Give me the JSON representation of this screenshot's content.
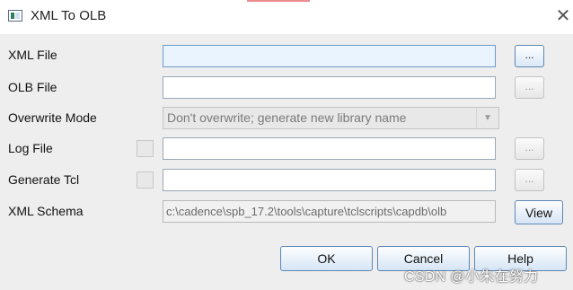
{
  "window": {
    "title": "XML To OLB"
  },
  "rows": {
    "xml_file": {
      "label": "XML File",
      "value": "",
      "browse_label": "..."
    },
    "olb_file": {
      "label": "OLB File",
      "value": "",
      "browse_label": "..."
    },
    "overwrite_mode": {
      "label": "Overwrite Mode",
      "selected": "Don't overwrite; generate new library name"
    },
    "log_file": {
      "label": "Log File",
      "value": "",
      "browse_label": "..."
    },
    "generate_tcl": {
      "label": "Generate Tcl",
      "value": "",
      "browse_label": "..."
    },
    "xml_schema": {
      "label": "XML Schema",
      "value": "c:\\cadence\\spb_17.2\\tools\\capture\\tclscripts\\capdb\\olb",
      "view_label": "View"
    }
  },
  "buttons": {
    "ok": "OK",
    "cancel": "Cancel",
    "help": "Help"
  },
  "watermark": "CSDN @小朱在努力"
}
